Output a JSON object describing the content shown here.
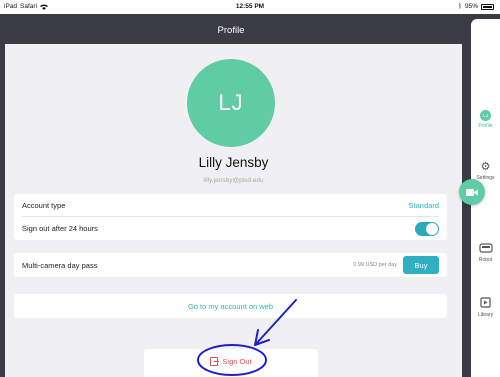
{
  "status_bar": {
    "carrier": "Safari",
    "time": "12:55 PM",
    "battery_percent": "95%"
  },
  "header": {
    "title": "Profile"
  },
  "profile": {
    "initials": "LJ",
    "name": "Lilly Jensby",
    "email": "lilly.jensby@pisd.edu"
  },
  "account": {
    "account_type_label": "Account type",
    "account_type_value": "Standard",
    "sign_out_label": "Sign out after 24 hours",
    "sign_out_enabled": true
  },
  "camera_pass": {
    "label": "Multi-camera day pass",
    "price": "0.99 USD per day",
    "buy_label": "Buy"
  },
  "web_link": {
    "label": "Go to my account on web"
  },
  "sign_out": {
    "label": "Sign Out"
  },
  "sidebar": {
    "items": [
      {
        "label": "Profile",
        "icon": "avatar-icon",
        "initials": "LJ"
      },
      {
        "label": "Settings",
        "icon": "gear-icon"
      },
      {
        "label": "Robot",
        "icon": "robot-icon"
      },
      {
        "label": "Library",
        "icon": "library-icon"
      }
    ]
  },
  "colors": {
    "accent_green": "#5fcca5",
    "accent_teal": "#2ab5c0",
    "header_bg": "#3a3b45",
    "sign_out_red": "#e0524c",
    "annotation_blue": "#1c22c8"
  }
}
